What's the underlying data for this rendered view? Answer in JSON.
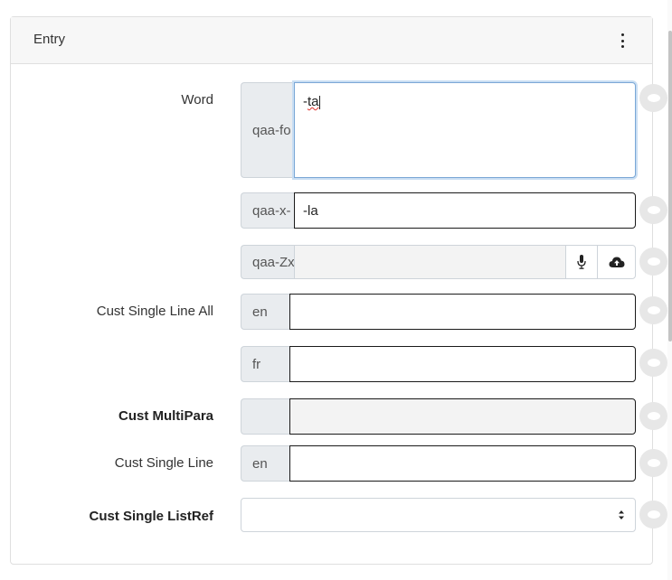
{
  "card": {
    "title": "Entry"
  },
  "fields": {
    "word": {
      "label": "Word",
      "writing_systems": [
        {
          "code": "qaa-fo",
          "value_prefix": "-",
          "value_word": "ta"
        },
        {
          "code": "qaa-x-",
          "value": "-la"
        },
        {
          "code": "qaa-Zx",
          "value": ""
        }
      ]
    },
    "cust_single_line_all": {
      "label": "Cust Single Line All",
      "writing_systems": [
        {
          "code": "en",
          "value": ""
        },
        {
          "code": "fr",
          "value": ""
        }
      ]
    },
    "cust_multipara": {
      "label": "Cust MultiPara",
      "value": ""
    },
    "cust_single_line": {
      "label": "Cust Single Line",
      "writing_systems": [
        {
          "code": "en",
          "value": ""
        }
      ]
    },
    "cust_single_listref": {
      "label": "Cust Single ListRef",
      "selected": ""
    }
  },
  "icons": {
    "menu": "kebab-menu-icon",
    "record": "microphone-icon",
    "upload": "cloud-upload-icon",
    "comment": "comment-bubble-icon",
    "select": "select-arrows-icon"
  },
  "colors": {
    "focus_border": "#7aa7d6",
    "addon_bg": "#e9ecef",
    "spellcheck": "#e0312b"
  }
}
